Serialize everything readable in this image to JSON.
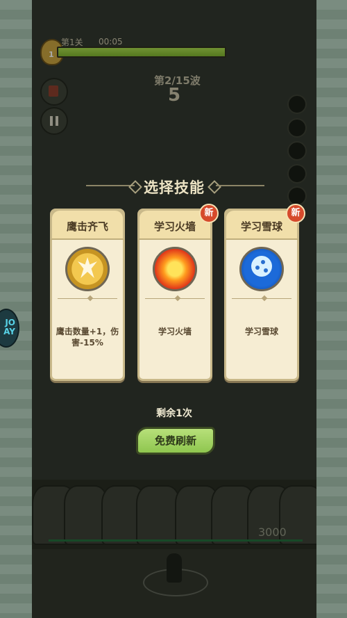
{
  "hud": {
    "level_number": "1",
    "stage_label": "第1关",
    "timer": "00:05",
    "wave_label": "第2/15波",
    "wave_countdown": "5",
    "player_hp": "3000",
    "side_badge": "JO AY"
  },
  "modal": {
    "title": "选择技能",
    "cards": [
      {
        "name": "鹰击齐飞",
        "icon": "eagle-icon",
        "description": "鹰击数量+1，伤害-15%",
        "is_new": false
      },
      {
        "name": "学习火墙",
        "icon": "fire-icon",
        "description": "学习火墙",
        "is_new": true
      },
      {
        "name": "学习雪球",
        "icon": "snowball-icon",
        "description": "学习雪球",
        "is_new": true
      }
    ],
    "new_badge_text": "新",
    "remaining_text": "剩余1次",
    "refresh_button": "免费刷新"
  },
  "colors": {
    "accent_green": "#8fc64f",
    "card_bg": "#f6edd3",
    "new_badge": "#d64a2c"
  }
}
